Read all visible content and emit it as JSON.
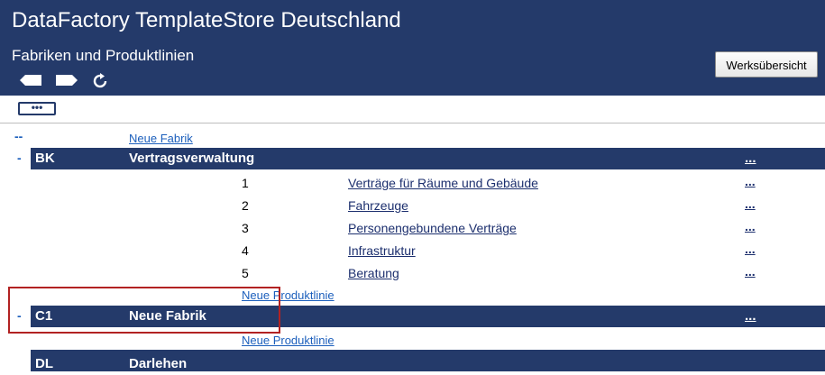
{
  "header": {
    "title": "DataFactory TemplateStore Deutschland",
    "subtitle": "Fabriken und Produktlinien",
    "overview_button": "Werksübersicht",
    "icons": [
      "back-arrow-icon",
      "forward-arrow-icon",
      "refresh-icon"
    ]
  },
  "toolbar": {
    "more_label": "•••"
  },
  "top": {
    "dashes": "--",
    "new_factory_link": "Neue Fabrik"
  },
  "factories": [
    {
      "collapse": "-",
      "code": "BK",
      "name": "Vertragsverwaltung",
      "more": "...",
      "lines": [
        {
          "num": "1",
          "name": "Verträge für Räume und Gebäude",
          "more": "..."
        },
        {
          "num": "2",
          "name": "Fahrzeuge",
          "more": "..."
        },
        {
          "num": "3",
          "name": "Personengebundene Verträge",
          "more": "..."
        },
        {
          "num": "4",
          "name": "Infrastruktur",
          "more": "..."
        },
        {
          "num": "5",
          "name": "Beratung",
          "more": "..."
        }
      ],
      "new_line_link": "Neue Produktlinie"
    },
    {
      "collapse": "-",
      "code": "C1",
      "name": "Neue Fabrik",
      "more": "...",
      "new_line_link": "Neue Produktlinie"
    },
    {
      "code": "DL",
      "name": "Darlehen"
    }
  ]
}
